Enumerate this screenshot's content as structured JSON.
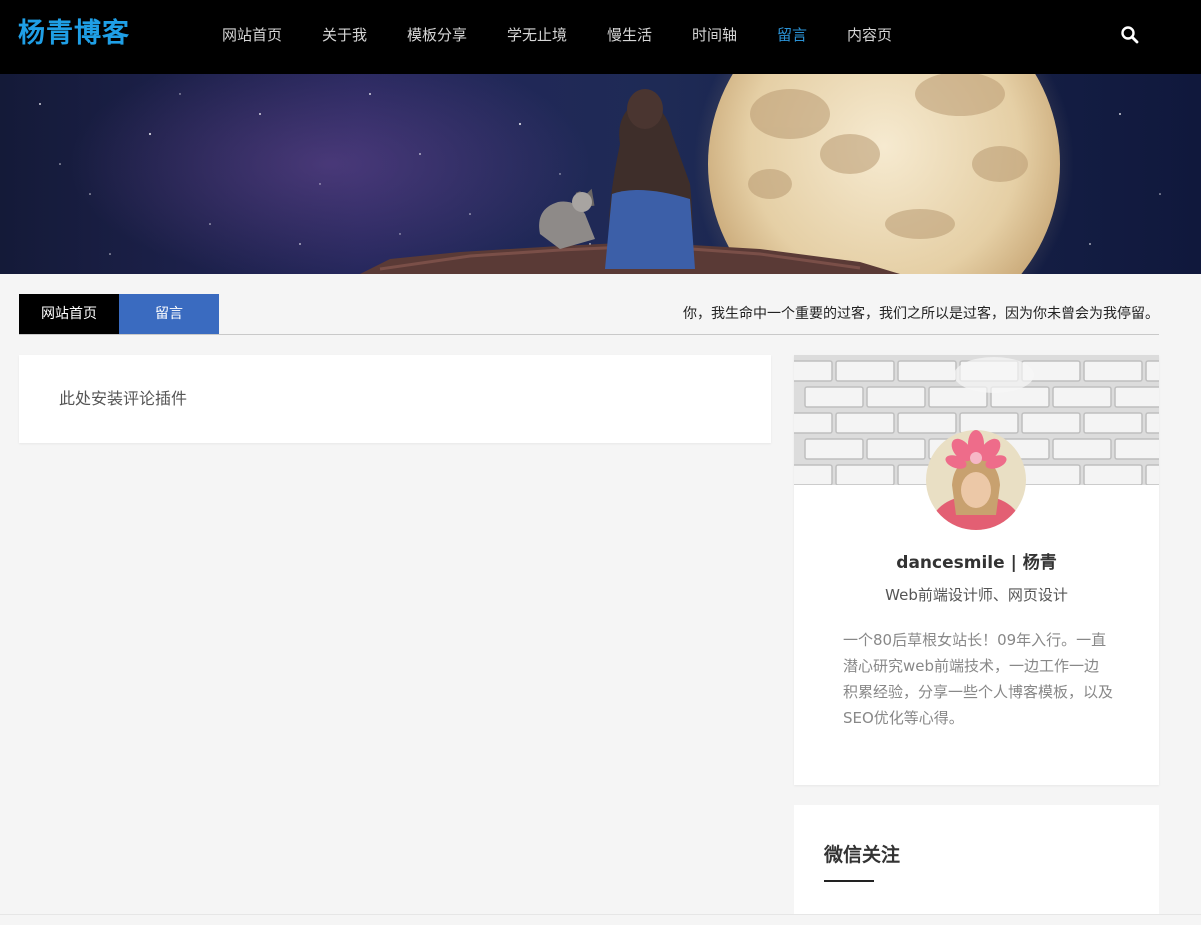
{
  "header": {
    "logo": "杨青博客",
    "nav": [
      {
        "label": "网站首页",
        "active": false
      },
      {
        "label": "关于我",
        "active": false
      },
      {
        "label": "模板分享",
        "active": false
      },
      {
        "label": "学无止境",
        "active": false
      },
      {
        "label": "慢生活",
        "active": false
      },
      {
        "label": "时间轴",
        "active": false
      },
      {
        "label": "留言",
        "active": true
      },
      {
        "label": "内容页",
        "active": false
      }
    ],
    "search_icon": "search-icon"
  },
  "breadcrumb": {
    "home": "网站首页",
    "current": "留言",
    "slogan": "你，我生命中一个重要的过客，我们之所以是过客，因为你未曾会为我停留。"
  },
  "main": {
    "placeholder": "此处安装评论插件"
  },
  "profile": {
    "name": "dancesmile | 杨青",
    "role": "Web前端设计师、网页设计",
    "bio": "一个80后草根女站长！09年入行。一直潜心研究web前端技术，一边工作一边积累经验，分享一些个人博客模板，以及SEO优化等心得。"
  },
  "wechat": {
    "title": "微信关注"
  },
  "colors": {
    "logo": "#1f9fe6",
    "nav_active": "#2b93d6",
    "crumb_current": "#3a6bc0",
    "header_bg": "#000000"
  }
}
